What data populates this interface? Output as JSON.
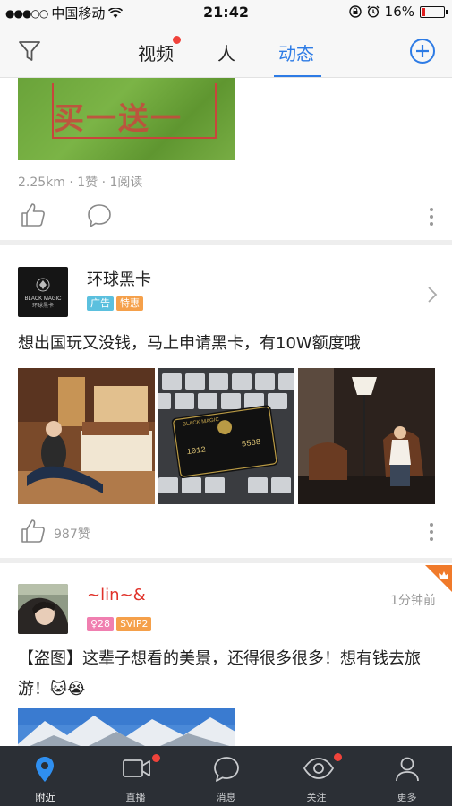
{
  "status_bar": {
    "carrier": "中国移动",
    "time": "21:42",
    "battery": "16%",
    "battery_level": 0.16
  },
  "top_nav": {
    "tabs": [
      {
        "label": "视频",
        "badge": true
      },
      {
        "label": "人",
        "badge": false
      },
      {
        "label": "动态",
        "badge": false,
        "active": true
      }
    ],
    "accent": "#2d7be5"
  },
  "feed": {
    "post0": {
      "image_text": "买一送一",
      "meta": "2.25km · 1赞 · 1阅读"
    },
    "post1": {
      "author": "环球黑卡",
      "avatar_text": "BLACK MAGIC",
      "avatar_subtext": "环球黑卡",
      "tags": [
        {
          "label": "广告",
          "color": "#5bc0de"
        },
        {
          "label": "特惠",
          "color": "#f5a04a"
        }
      ],
      "text": "想出国玩又没钱，马上申请黑卡，有10W额度哦",
      "card_number": "1012",
      "card_number2": "5588",
      "card_brand": "BLACK MAGIC",
      "likes": "987赞"
    },
    "post2": {
      "author": "~lin~&",
      "author_color": "#e0322a",
      "tags": [
        {
          "label": "♀28",
          "color": "#f07fb0"
        },
        {
          "label": "SVIP2",
          "color": "#f5a04a"
        }
      ],
      "time": "1分钟前",
      "text": "【盗图】这辈子想看的美景，还得很多很多！想有钱去旅游！🐱😭"
    }
  },
  "tab_bar": {
    "items": [
      {
        "label": "附近",
        "icon": "location-icon",
        "active": true
      },
      {
        "label": "直播",
        "icon": "video-camera-icon",
        "badge": true
      },
      {
        "label": "消息",
        "icon": "chat-bubble-icon"
      },
      {
        "label": "关注",
        "icon": "eye-icon",
        "badge": true
      },
      {
        "label": "更多",
        "icon": "person-icon"
      }
    ]
  }
}
